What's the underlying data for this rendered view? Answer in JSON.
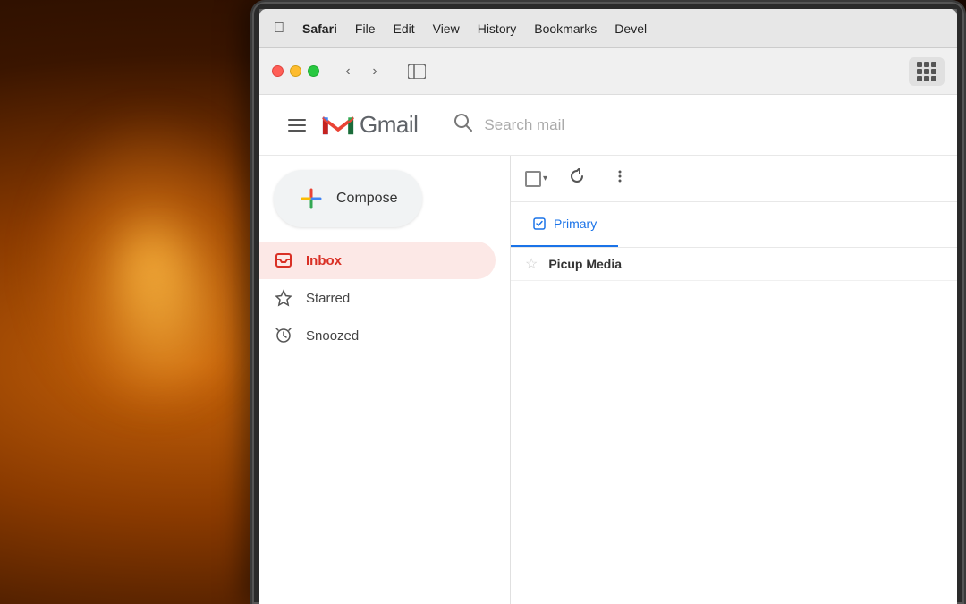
{
  "bg": {
    "description": "warm bokeh background with orange lamp light"
  },
  "mac_menubar": {
    "apple_symbol": "",
    "items": [
      {
        "id": "safari",
        "label": "Safari",
        "bold": true
      },
      {
        "id": "file",
        "label": "File",
        "bold": false
      },
      {
        "id": "edit",
        "label": "Edit",
        "bold": false
      },
      {
        "id": "view",
        "label": "View",
        "bold": false
      },
      {
        "id": "history",
        "label": "History",
        "bold": false
      },
      {
        "id": "bookmarks",
        "label": "Bookmarks",
        "bold": false
      },
      {
        "id": "develop",
        "label": "Devel",
        "bold": false
      }
    ]
  },
  "safari_toolbar": {
    "back_tooltip": "Back",
    "forward_tooltip": "Forward",
    "sidebar_tooltip": "Show/Hide Sidebar"
  },
  "gmail": {
    "title": "Gmail",
    "search_placeholder": "Search mail",
    "compose_label": "Compose",
    "nav_items": [
      {
        "id": "inbox",
        "label": "Inbox",
        "active": true
      },
      {
        "id": "starred",
        "label": "Starred",
        "active": false
      },
      {
        "id": "snoozed",
        "label": "Snoozed",
        "active": false
      }
    ],
    "email_toolbar": {
      "select_all_tooltip": "Select all",
      "refresh_tooltip": "Refresh",
      "more_tooltip": "More"
    },
    "categories": [
      {
        "id": "primary",
        "label": "Primary",
        "active": true
      }
    ],
    "email_rows": [
      {
        "sender": "Picup Media",
        "subject": "",
        "starred": false
      }
    ]
  }
}
